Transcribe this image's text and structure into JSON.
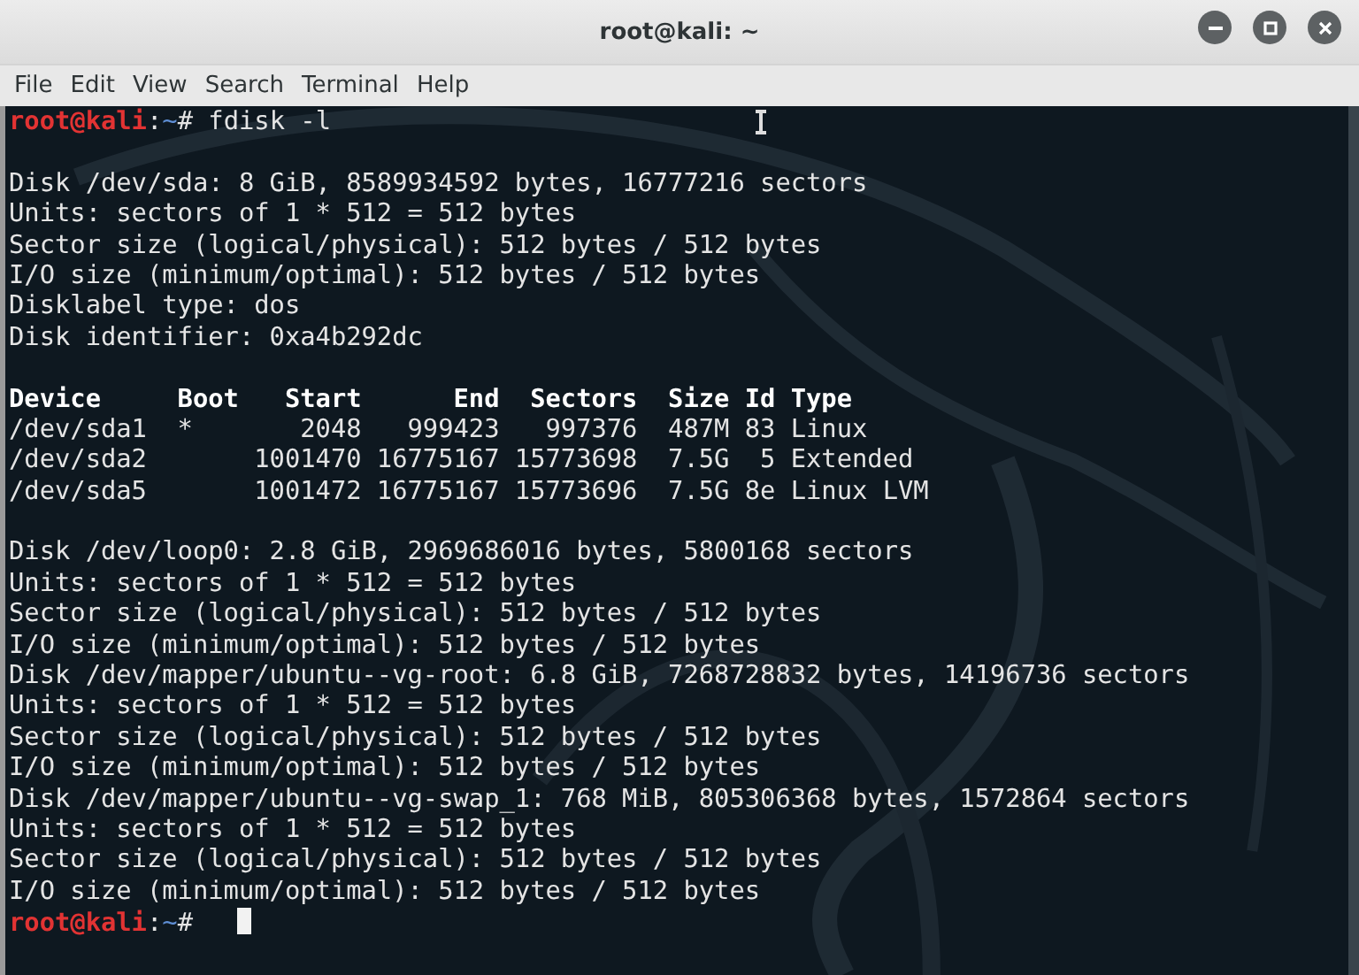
{
  "window": {
    "title": "root@kali: ~"
  },
  "menu": [
    "File",
    "Edit",
    "View",
    "Search",
    "Terminal",
    "Help"
  ],
  "terminal": {
    "lines": [
      {
        "kind": "prompt",
        "prompt": [
          {
            "kind": "user",
            "text": "root@kali"
          },
          {
            "kind": "plain",
            "text": ":"
          },
          {
            "kind": "path",
            "text": "~"
          },
          {
            "kind": "plain",
            "text": "#"
          }
        ],
        "command": "fdisk -l"
      },
      {
        "kind": "blank"
      },
      {
        "kind": "text",
        "text": "Disk /dev/sda: 8 GiB, 8589934592 bytes, 16777216 sectors"
      },
      {
        "kind": "text",
        "text": "Units: sectors of 1 * 512 = 512 bytes"
      },
      {
        "kind": "text",
        "text": "Sector size (logical/physical): 512 bytes / 512 bytes"
      },
      {
        "kind": "text",
        "text": "I/O size (minimum/optimal): 512 bytes / 512 bytes"
      },
      {
        "kind": "text",
        "text": "Disklabel type: dos"
      },
      {
        "kind": "text",
        "text": "Disk identifier: 0xa4b292dc"
      },
      {
        "kind": "blank"
      },
      {
        "kind": "header",
        "text": "Device     Boot   Start      End  Sectors  Size Id Type"
      },
      {
        "kind": "text",
        "text": "/dev/sda1  *       2048   999423   997376  487M 83 Linux"
      },
      {
        "kind": "text",
        "text": "/dev/sda2       1001470 16775167 15773698  7.5G  5 Extended"
      },
      {
        "kind": "text",
        "text": "/dev/sda5       1001472 16775167 15773696  7.5G 8e Linux LVM"
      },
      {
        "kind": "blank"
      },
      {
        "kind": "text",
        "text": "Disk /dev/loop0: 2.8 GiB, 2969686016 bytes, 5800168 sectors"
      },
      {
        "kind": "text",
        "text": "Units: sectors of 1 * 512 = 512 bytes"
      },
      {
        "kind": "text",
        "text": "Sector size (logical/physical): 512 bytes / 512 bytes"
      },
      {
        "kind": "text",
        "text": "I/O size (minimum/optimal): 512 bytes / 512 bytes"
      },
      {
        "kind": "text",
        "text": "Disk /dev/mapper/ubuntu--vg-root: 6.8 GiB, 7268728832 bytes, 14196736 sectors"
      },
      {
        "kind": "text",
        "text": "Units: sectors of 1 * 512 = 512 bytes"
      },
      {
        "kind": "text",
        "text": "Sector size (logical/physical): 512 bytes / 512 bytes"
      },
      {
        "kind": "text",
        "text": "I/O size (minimum/optimal): 512 bytes / 512 bytes"
      },
      {
        "kind": "text",
        "text": "Disk /dev/mapper/ubuntu--vg-swap_1: 768 MiB, 805306368 bytes, 1572864 sectors"
      },
      {
        "kind": "text",
        "text": "Units: sectors of 1 * 512 = 512 bytes"
      },
      {
        "kind": "text",
        "text": "Sector size (logical/physical): 512 bytes / 512 bytes"
      },
      {
        "kind": "text",
        "text": "I/O size (minimum/optimal): 512 bytes / 512 bytes"
      },
      {
        "kind": "prompt",
        "prompt": [
          {
            "kind": "user",
            "text": "root@kali"
          },
          {
            "kind": "plain",
            "text": ":"
          },
          {
            "kind": "path",
            "text": "~"
          },
          {
            "kind": "plain",
            "text": "#"
          }
        ],
        "cursor": true
      }
    ]
  }
}
